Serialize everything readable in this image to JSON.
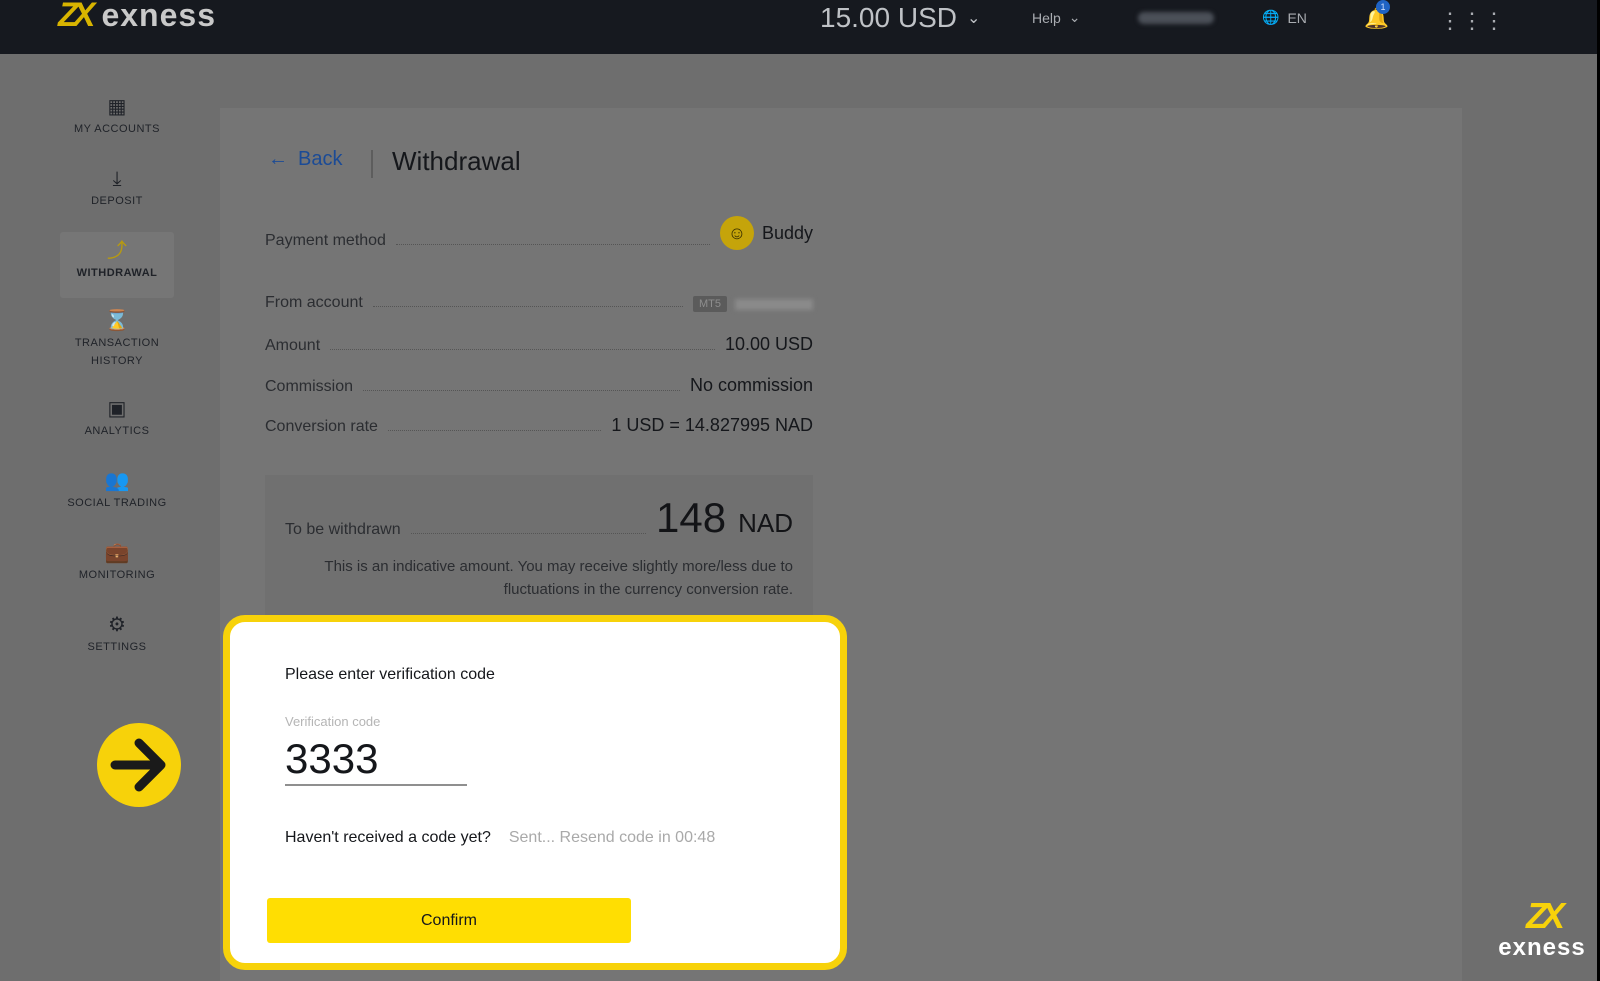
{
  "header": {
    "brand": "exness",
    "balance": "15.00 USD",
    "help": "Help",
    "language": "EN",
    "notification_count": "1"
  },
  "sidebar": {
    "items": [
      {
        "label": "MY ACCOUNTS",
        "icon": "accounts-grid-icon"
      },
      {
        "label": "DEPOSIT",
        "icon": "download-icon"
      },
      {
        "label": "WITHDRAWAL",
        "icon": "upload-icon",
        "active": true
      },
      {
        "label": "TRANSACTION HISTORY",
        "icon": "hourglass-icon"
      },
      {
        "label": "ANALYTICS",
        "icon": "chart-screen-icon"
      },
      {
        "label": "SOCIAL TRADING",
        "icon": "people-icon"
      },
      {
        "label": "MONITORING",
        "icon": "briefcase-icon"
      },
      {
        "label": "SETTINGS",
        "icon": "gear-icon"
      }
    ]
  },
  "page": {
    "back": "Back",
    "title": "Withdrawal"
  },
  "details": {
    "payment_method_label": "Payment method",
    "payment_method_value": "Buddy",
    "from_account_label": "From account",
    "from_account_tag": "MT5",
    "amount_label": "Amount",
    "amount_value": "10.00 USD",
    "commission_label": "Commission",
    "commission_value": "No commission",
    "conversion_label": "Conversion rate",
    "conversion_value": "1 USD = 14.827995 NAD"
  },
  "withdrawn": {
    "label": "To be withdrawn",
    "amount": "148",
    "currency": "NAD",
    "note": "This is an indicative amount. You may receive slightly more/less due to fluctuations in the currency conversion rate."
  },
  "verification": {
    "title": "Please enter verification code",
    "field_label": "Verification code",
    "code": "3333",
    "resend_question": "Haven't received a code yet?",
    "resend_status": "Sent... Resend code in 00:48",
    "confirm": "Confirm"
  },
  "colors": {
    "highlight": "#f7d20a",
    "confirm_button": "#ffde02",
    "back_link": "#1b4b96"
  }
}
